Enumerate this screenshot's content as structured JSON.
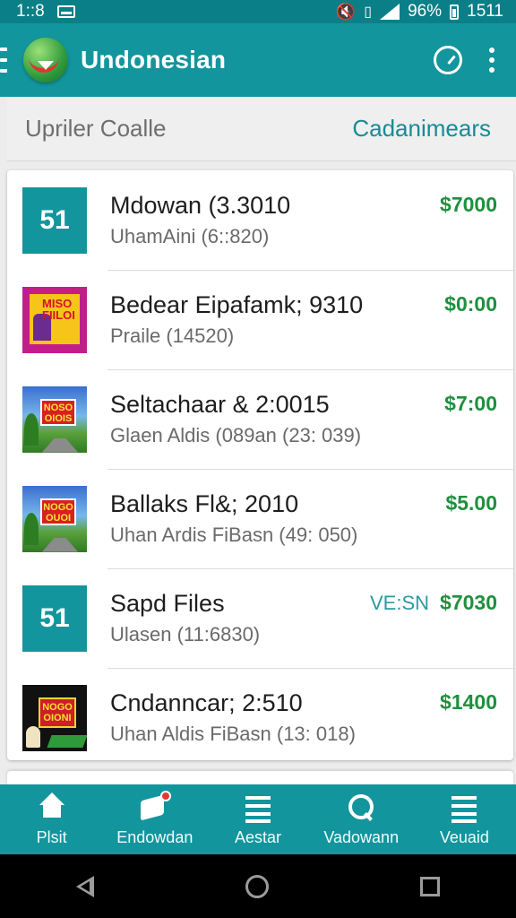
{
  "status_bar": {
    "time": "1::8",
    "battery_text": "96%",
    "clock": "1511"
  },
  "app_bar": {
    "title": "Undonesian"
  },
  "subheader": {
    "left": "Upriler Coalle",
    "right": "Cadanimears"
  },
  "items": [
    {
      "title": "Mdowan (3.3010",
      "subtitle": "UhamAini (6::820)",
      "price": "$7000",
      "extra": "",
      "thumb_text": "51",
      "thumb_style": "teal"
    },
    {
      "title": "Bedear Eipafamk; 9310",
      "subtitle": "Praile (14520)",
      "price": "$0:00",
      "extra": "",
      "thumb_text": "MISO FIILOI",
      "thumb_style": "magenta"
    },
    {
      "title": "Seltachaar & 2:0015",
      "subtitle": "Glaen Aldis  (089an (23: 039)",
      "price": "$7:00",
      "extra": "",
      "thumb_text": "NOSO OIOIS",
      "thumb_style": "tropic"
    },
    {
      "title": "Ballaks Fl&; 2010",
      "subtitle": "Uhan Ardis  FiBasn (49: 050)",
      "price": "$5.00",
      "extra": "",
      "thumb_text": "NOGO OUOI",
      "thumb_style": "tropic"
    },
    {
      "title": "Sapd Files",
      "subtitle": "Ulasen (11:6830)",
      "price": "$7030",
      "extra": "VE:SN",
      "thumb_text": "51",
      "thumb_style": "teal"
    },
    {
      "title": "Cndanncar; 2:510",
      "subtitle": "Uhan Aldis  FiBasn (13: 018)",
      "price": "$1400",
      "extra": "",
      "thumb_text": "NOGO OIONI",
      "thumb_style": "dark"
    }
  ],
  "bottom_nav": [
    {
      "label": "Plsit",
      "icon": "home-icon"
    },
    {
      "label": "Endowdan",
      "icon": "chat-icon"
    },
    {
      "label": "Aestar",
      "icon": "list-icon"
    },
    {
      "label": "Vadowann",
      "icon": "search-icon"
    },
    {
      "label": "Veuaid",
      "icon": "menu-icon"
    }
  ]
}
